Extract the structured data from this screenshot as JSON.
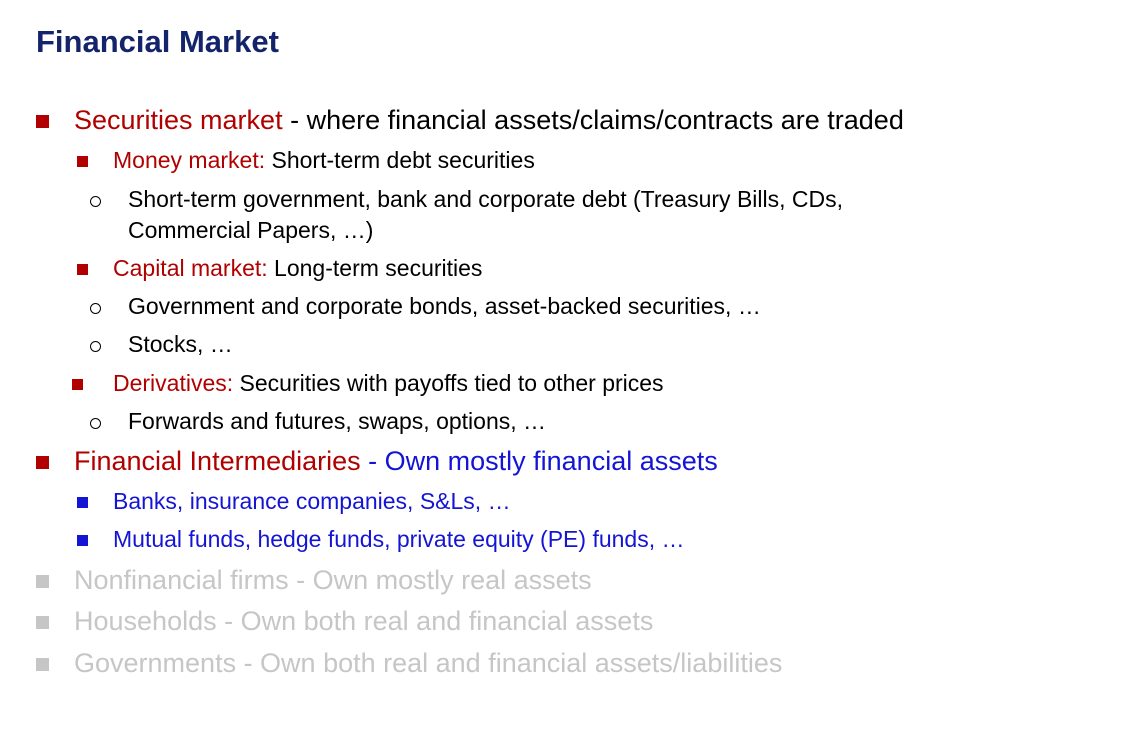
{
  "slide": {
    "title": "Financial Market"
  },
  "colors": {
    "title": "#13246b",
    "red": "#b00000",
    "blue": "#1414d4",
    "gray": "#c6c6c6",
    "text": "#000000"
  },
  "outline": {
    "securities": {
      "label": "Securities market",
      "desc": " - where financial assets/claims/contracts are traded",
      "money_market": {
        "label": "Money market:",
        "desc": " Short-term debt securities",
        "sub1_line1": "Short-term government, bank and corporate debt (Treasury Bills, CDs,",
        "sub1_line2": "Commercial Papers, …)"
      },
      "capital_market": {
        "label": "Capital market:",
        "desc": " Long-term securities",
        "sub1": "Government and corporate bonds, asset-backed securities, …",
        "sub2": "Stocks, …"
      },
      "derivatives": {
        "label": "Derivatives:",
        "desc": " Securities with payoffs tied to other prices",
        "sub1": "Forwards and futures, swaps, options, …"
      }
    },
    "intermediaries": {
      "label": "Financial Intermediaries",
      "desc": " - Own mostly financial assets",
      "item1": "Banks, insurance companies, S&Ls, …",
      "item2": "Mutual funds, hedge funds, private equity (PE) funds, …"
    },
    "nonfinancial": "Nonfinancial firms - Own mostly real assets",
    "households": "Households - Own both real and financial assets",
    "governments": "Governments - Own both real and financial assets/liabilities"
  }
}
